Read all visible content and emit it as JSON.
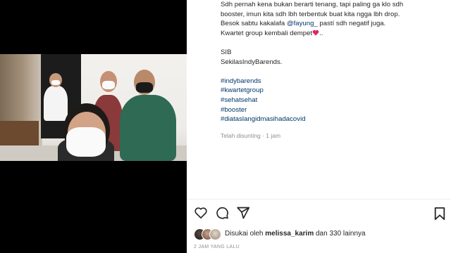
{
  "caption": {
    "lines": [
      "Sdh pernah kena bukan berarti tenang, tapi paling ga klo sdh",
      "booster, imun kita sdh lbh terbentuk buat kita ngga lbh drop.",
      "Kwartet group kembali dempet",
      "SIB",
      "SekilasIndyBarends."
    ],
    "line3_before": "Besok sabtu kakalafa ",
    "line3_mention": "@fayung_",
    "line3_after": " pastí sdh negatif juga.",
    "line4_after": "..",
    "hashtags": [
      "#indybarends",
      "#kwartetgroup",
      "#sehatsehat",
      "#booster",
      "#diataslangidmasihadacovid"
    ],
    "edited_time": "Telah disunting · 1 jam"
  },
  "likes": {
    "prefix": "Disukai oleh",
    "user": "melissa_karim",
    "suffix": "dan 330 lainnya"
  },
  "post_date": "2 JAM YANG LALU",
  "icons": [
    "heart-icon",
    "comment-icon",
    "share-icon",
    "bookmark-icon"
  ],
  "colors": {
    "heart": "#e0245e",
    "link": "#00376b",
    "muted": "#8e8e8e"
  }
}
